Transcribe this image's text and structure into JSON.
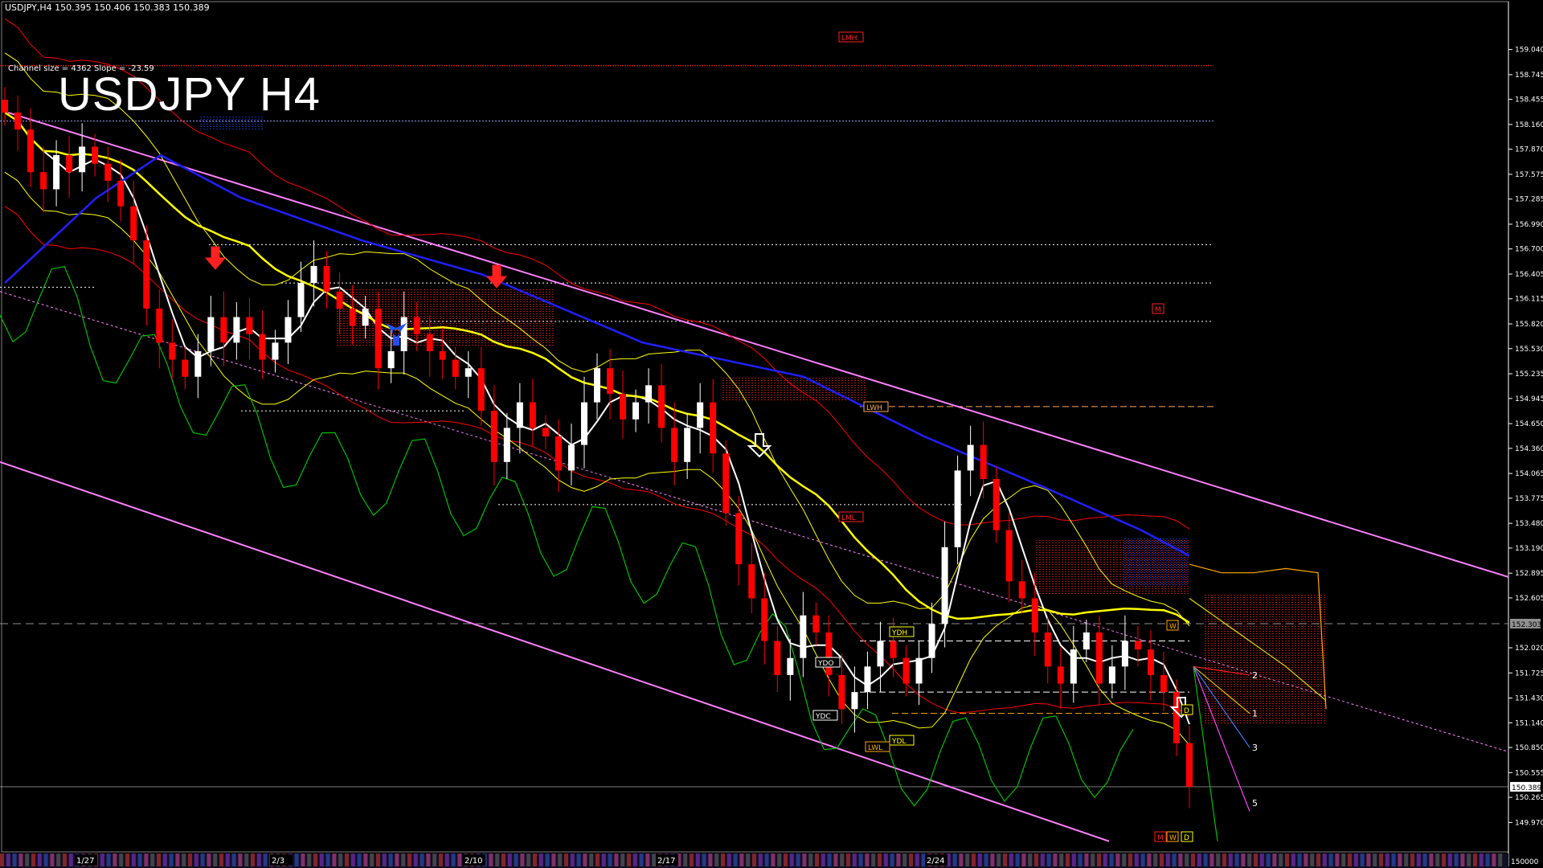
{
  "window": {
    "header": "USDJPY,H4  150.395 150.406 150.383 150.389",
    "channel_info": "Channel size = 4362 Slope = -23.59",
    "big_title": "USDJPY H4"
  },
  "colors": {
    "background": "#000000",
    "bull_candle": "#ffffff",
    "bear_candle": "#ff0000",
    "channel": "#ff80ff",
    "ma_white": "#ffffff",
    "ma_yellow": "#ffff00",
    "ma_blue": "#2020ff",
    "bands": "#ff0000",
    "chikou": "#00c000",
    "cloud_blue": "#2040ff",
    "cloud_red": "#ff2020",
    "axis": "#ffffff"
  },
  "chart_data": {
    "type": "candlestick",
    "symbol": "USDJPY",
    "timeframe": "H4",
    "ylim": [
      149.7,
      159.3
    ],
    "y_ticks": [
      "159.040",
      "158.745",
      "158.455",
      "158.160",
      "157.870",
      "157.575",
      "157.285",
      "156.990",
      "156.700",
      "156.405",
      "156.115",
      "155.820",
      "155.530",
      "155.235",
      "154.945",
      "154.650",
      "154.360",
      "154.065",
      "153.775",
      "153.480",
      "153.190",
      "152.895",
      "152.605",
      "152.020",
      "151.725",
      "151.430",
      "151.140",
      "150.850",
      "150.555",
      "150.265",
      "149.970"
    ],
    "current_price_label": "152.303",
    "last_price_label": "150.389",
    "bottom_left_label": "150000",
    "x_labels": [
      "1/27",
      "2/3",
      "2/10",
      "2/17",
      "2/24"
    ],
    "close_path": [
      158.3,
      158.1,
      157.6,
      157.4,
      157.8,
      157.6,
      157.9,
      157.7,
      157.5,
      157.2,
      156.8,
      156.0,
      155.6,
      155.4,
      155.2,
      155.5,
      155.9,
      155.6,
      155.9,
      155.7,
      155.4,
      155.6,
      155.9,
      156.3,
      156.5,
      156.2,
      156.0,
      155.8,
      156.0,
      155.3,
      155.5,
      155.9,
      155.7,
      155.5,
      155.4,
      155.2,
      155.3,
      154.8,
      154.2,
      154.6,
      154.9,
      154.6,
      154.5,
      154.1,
      154.4,
      154.9,
      155.3,
      155.0,
      154.7,
      154.9,
      155.1,
      154.6,
      154.2,
      154.6,
      154.9,
      154.3,
      153.6,
      153.0,
      152.6,
      152.1,
      151.7,
      151.9,
      152.4,
      152.2,
      151.7,
      151.3,
      151.5,
      151.8,
      152.1,
      151.9,
      151.6,
      151.9,
      152.3,
      153.2,
      154.1,
      154.4,
      154.0,
      153.4,
      152.8,
      152.6,
      152.2,
      151.8,
      151.6,
      152.0,
      152.2,
      151.6,
      151.8,
      152.1,
      152.0,
      151.7,
      151.5,
      150.9,
      150.389
    ],
    "labels": {
      "LMH": "LMH",
      "M": "M",
      "LWH": "LWH",
      "LML": "LML",
      "YDH": "YDH",
      "YDO": "YDO",
      "YDC": "YDC",
      "YDL": "YDL",
      "LWL": "LWL",
      "W": "W",
      "D": "D"
    },
    "projection_labels": [
      "2",
      "1",
      "3",
      "5"
    ]
  }
}
